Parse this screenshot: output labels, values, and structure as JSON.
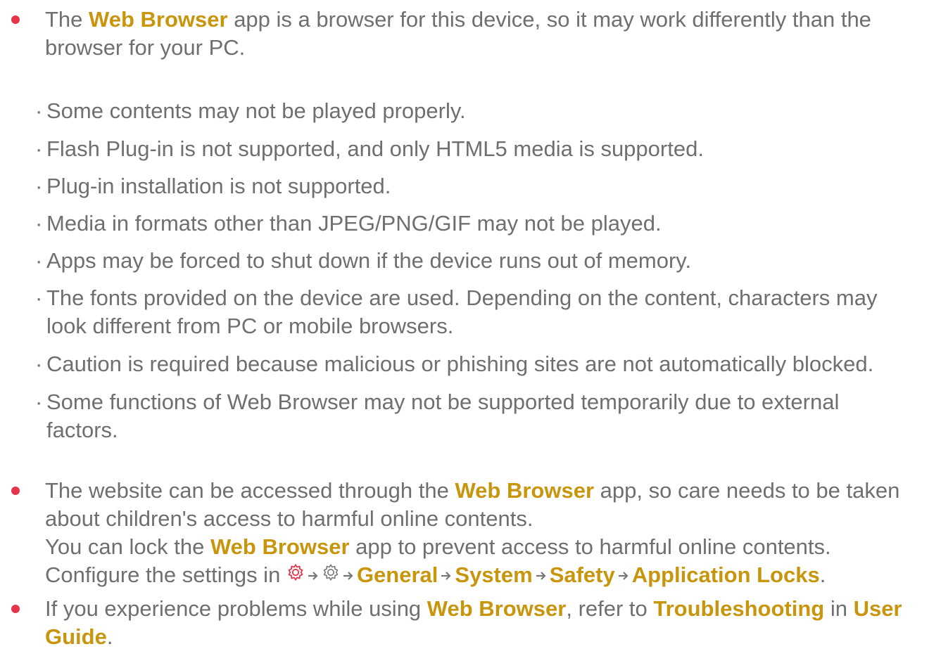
{
  "accent_color": "#c8950c",
  "bullet_color": "#e8344a",
  "text_color": "#6f6f6f",
  "bullet1": {
    "prefix": "The ",
    "app_name": "Web Browser",
    "suffix_line1": " app is a browser for this device, so it may work differently than the",
    "line2": "browser for your PC."
  },
  "sub_items": [
    {
      "text": "Some contents may not be played properly."
    },
    {
      "text": "Flash Plug-in is not supported, and only HTML5 media is supported."
    },
    {
      "text": "Plug-in installation is not supported."
    },
    {
      "text": "Media in formats other than JPEG/PNG/GIF may not be played."
    },
    {
      "text": "Apps may be forced to shut down if the device runs out of memory."
    },
    {
      "text": "The fonts provided on the device are used. Depending on the content, characters may",
      "text2": "look different from PC or mobile browsers."
    },
    {
      "text": "Caution is required because malicious or phishing sites are not automatically blocked."
    },
    {
      "text": "Some functions of Web Browser may not be supported temporarily due to external",
      "text2": "factors."
    }
  ],
  "sub_marker": "·",
  "bullet2": {
    "line1_prefix": "The website can be accessed through the ",
    "app_name": "Web Browser",
    "line1_suffix": " app, so care needs to be taken",
    "line2": "about children's access to harmful online contents.",
    "line3_prefix": "You can lock the ",
    "line3_suffix": " app to prevent access to harmful online contents.",
    "line4_prefix": "Configure the settings in ",
    "path": [
      "General",
      "System",
      "Safety",
      "Application Locks"
    ],
    "line4_end": "."
  },
  "icons": {
    "settings_primary": "gear-icon-red",
    "settings_secondary": "gear-icon-outline",
    "arrow": "arrow-right-icon"
  },
  "bullet3": {
    "prefix": "If you experience problems while using ",
    "app_name": "Web Browser",
    "mid": ", refer to ",
    "troubleshooting": "Troubleshooting",
    "in_word": " in ",
    "user": "User",
    "guide": "Guide",
    "end": "."
  }
}
